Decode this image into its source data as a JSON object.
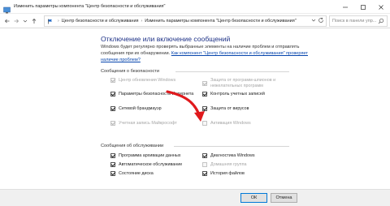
{
  "window": {
    "title": "Изменить параметры компонента \"Центр безопасности и обслуживания\""
  },
  "address": {
    "crumbs": [
      "Центр безопасности и обслуживания",
      "Изменить параметры компонента \"Центр безопасности и обслуживания\""
    ],
    "search_placeholder": "Поиск в панели упр..."
  },
  "page": {
    "title": "Отключение или включение сообщений",
    "description": "Windows будет регулярно проверять выбранные элементы на наличие проблем и отправлять сообщения при их обнаружении.",
    "link": "Как компонент \"Центр безопасности и обслуживания\" проверяет наличие проблем?"
  },
  "security": {
    "heading": "Сообщения о безопасности",
    "items": [
      {
        "label": "Центр обновления Windows",
        "checked": true,
        "disabled": true
      },
      {
        "label": "Защита от программ-шпионов и нежелательных программ",
        "checked": true,
        "disabled": true
      },
      {
        "label": "Параметры безопасности Интернета",
        "checked": true,
        "disabled": false
      },
      {
        "label": "Контроль учетных записей",
        "checked": true,
        "disabled": false
      },
      {
        "label": "Сетевой брандмауэр",
        "checked": true,
        "disabled": false
      },
      {
        "label": "Защита от вирусов",
        "checked": true,
        "disabled": false
      },
      {
        "label": "Учетная запись Майкрософт",
        "checked": true,
        "disabled": true
      },
      {
        "label": "Активация Windows",
        "checked": false,
        "disabled": true
      }
    ]
  },
  "maintenance": {
    "heading": "Сообщения об обслуживании",
    "items": [
      {
        "label": "Программа архивации данных",
        "checked": true,
        "disabled": false
      },
      {
        "label": "Диагностика Windows",
        "checked": true,
        "disabled": false
      },
      {
        "label": "Автоматическое обслуживание",
        "checked": true,
        "disabled": false
      },
      {
        "label": "Домашняя группа",
        "checked": false,
        "disabled": true
      },
      {
        "label": "Состояние диска",
        "checked": true,
        "disabled": false
      },
      {
        "label": "История файлов",
        "checked": true,
        "disabled": false
      }
    ]
  },
  "buttons": {
    "ok": "ОК",
    "cancel": "Отмена"
  },
  "colors": {
    "title_blue": "#1e3287",
    "link_blue": "#0645ad",
    "arrow_red": "#e0191c"
  }
}
